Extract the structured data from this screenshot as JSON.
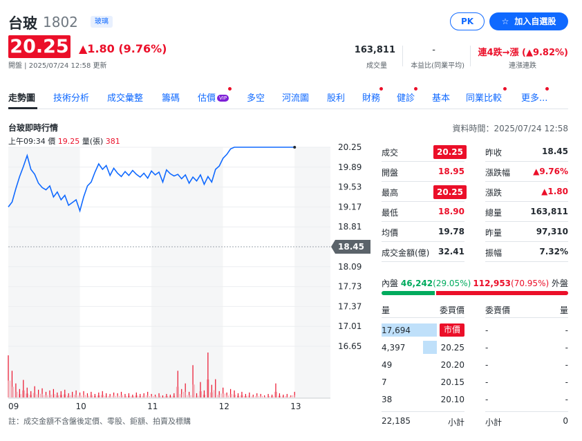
{
  "header": {
    "name": "台玻",
    "code": "1802",
    "industry": "玻璃",
    "pk_label": "PK",
    "watchlist_label": "加入自選股",
    "price": "20.25",
    "change": "▲1.80 (9.76%)",
    "status": "開盤 | 2025/07/24 12:58 更新",
    "stats": [
      {
        "value": "163,811",
        "label": "成交量"
      },
      {
        "value": "-",
        "label": "本益比(同業平均)"
      },
      {
        "value": "連4跌→漲 (▲9.82%)",
        "label": "連漲連跌"
      }
    ]
  },
  "tabs": [
    {
      "label": "走勢圖",
      "active": true
    },
    {
      "label": "技術分析"
    },
    {
      "label": "成交彙整"
    },
    {
      "label": "籌碼"
    },
    {
      "label": "估價",
      "badge": "VIP"
    },
    {
      "label": "多空"
    },
    {
      "label": "河流圖"
    },
    {
      "label": "股利"
    },
    {
      "label": "財務"
    },
    {
      "label": "健診"
    },
    {
      "label": "基本"
    },
    {
      "label": "同業比較"
    },
    {
      "label": "更多..."
    }
  ],
  "chart": {
    "title": "台玻即時行情",
    "data_time": "資料時間：2025/07/24 12:58",
    "hover": {
      "time": "上午09:34",
      "price_label": "價",
      "price": "19.25",
      "volume_label": "量(張)",
      "volume": "381"
    },
    "y_ticks": [
      "20.25",
      "19.89",
      "19.53",
      "19.17",
      "18.81",
      "18.45",
      "18.09",
      "17.73",
      "17.37",
      "17.01",
      "16.65"
    ],
    "ref_price": "18.45",
    "x_ticks": [
      "09",
      "10",
      "11",
      "12",
      "13"
    ],
    "footnote": "註：成交金額不含盤後定價、零股、鉅額、拍賣及標購"
  },
  "chart_data": {
    "type": "line",
    "title": "台玻即時行情",
    "x_ticks": [
      "09",
      "10",
      "11",
      "12",
      "13"
    ],
    "ylim": [
      16.65,
      20.25
    ],
    "reference": 18.45,
    "series": [
      {
        "values": [
          19.17,
          19.26,
          19.5,
          19.72,
          19.9,
          20.1,
          19.85,
          19.76,
          19.6,
          19.52,
          19.48,
          19.55,
          19.35,
          19.44,
          19.3,
          19.38,
          19.2,
          19.25,
          19.3,
          19.1,
          19.35,
          19.55,
          19.62,
          19.8,
          19.95,
          19.85,
          19.92,
          19.74,
          19.87,
          19.78,
          19.72,
          19.81,
          19.74,
          19.83,
          19.76,
          19.71,
          19.78,
          19.69,
          19.82,
          19.75,
          19.8,
          19.62,
          19.84,
          19.77,
          19.73,
          19.76,
          19.68,
          19.75,
          19.6,
          19.71,
          19.64,
          19.75,
          19.58,
          19.72,
          19.62,
          19.85,
          19.91,
          20.05,
          20.12,
          20.22,
          20.25,
          20.25,
          20.25,
          20.25,
          20.25,
          20.25,
          20.25,
          20.25,
          20.25,
          20.25,
          20.25,
          20.25,
          20.25,
          20.25,
          20.25,
          20.25,
          20.25
        ]
      }
    ],
    "volumes": [
      60,
      38,
      20,
      12,
      25,
      14,
      9,
      16,
      11,
      13,
      8,
      10,
      12,
      7,
      9,
      11,
      6,
      8,
      10,
      7,
      9,
      6,
      8,
      5,
      7,
      9,
      6,
      5,
      7,
      6,
      8,
      5,
      6,
      4,
      7,
      5,
      6,
      8,
      5,
      4,
      6,
      3,
      5,
      4,
      6,
      38,
      12,
      20,
      8,
      46,
      6,
      22,
      10,
      64,
      18,
      26,
      9,
      14,
      7,
      12,
      10,
      6,
      8,
      5,
      7,
      4,
      6,
      5,
      3,
      5,
      4,
      20,
      6,
      4,
      5,
      3,
      8
    ]
  },
  "quote": {
    "rows": [
      {
        "l1": "成交",
        "v1": "20.25",
        "b1": true,
        "l2": "昨收",
        "v2": "18.45",
        "c2": "dark"
      },
      {
        "l1": "開盤",
        "v1": "18.95",
        "c1": "red",
        "l2": "漲跌幅",
        "v2": "▲9.76%",
        "c2": "red"
      },
      {
        "l1": "最高",
        "v1": "20.25",
        "b1": true,
        "l2": "漲跌",
        "v2": "▲1.80",
        "c2": "red"
      },
      {
        "l1": "最低",
        "v1": "18.90",
        "c1": "red",
        "l2": "總量",
        "v2": "163,811",
        "c2": "dark"
      },
      {
        "l1": "均價",
        "v1": "19.78",
        "c1": "dark",
        "l2": "昨量",
        "v2": "97,310",
        "c2": "dark"
      },
      {
        "l1": "成交金額(億)",
        "v1": "32.41",
        "c1": "dark",
        "l2": "振幅",
        "v2": "7.32%",
        "c2": "dark"
      }
    ]
  },
  "orderbook": {
    "inner_label": "內盤",
    "inner_value": "46,242",
    "inner_pct": "(29.05%)",
    "outer_value": "112,953",
    "outer_pct": "(70.95%)",
    "outer_label": "外盤",
    "inner_fraction": 0.2905,
    "headers": [
      "量",
      "委買價",
      "委賣價",
      "量"
    ],
    "rows": [
      {
        "bid_vol": "17,694",
        "bid_price": "市價",
        "ask_price": "-",
        "ask_vol": "-",
        "bar": 1.0,
        "market": true
      },
      {
        "bid_vol": "4,397",
        "bid_price": "20.25",
        "ask_price": "-",
        "ask_vol": "-",
        "bar": 0.25
      },
      {
        "bid_vol": "49",
        "bid_price": "20.20",
        "ask_price": "-",
        "ask_vol": "-",
        "bar": 0
      },
      {
        "bid_vol": "7",
        "bid_price": "20.15",
        "ask_price": "-",
        "ask_vol": "-",
        "bar": 0
      },
      {
        "bid_vol": "38",
        "bid_price": "20.10",
        "ask_price": "-",
        "ask_vol": "-",
        "bar": 0
      }
    ],
    "total": {
      "bid_vol": "22,185",
      "bid_label": "小計",
      "ask_label": "小計",
      "ask_vol": "0"
    }
  }
}
